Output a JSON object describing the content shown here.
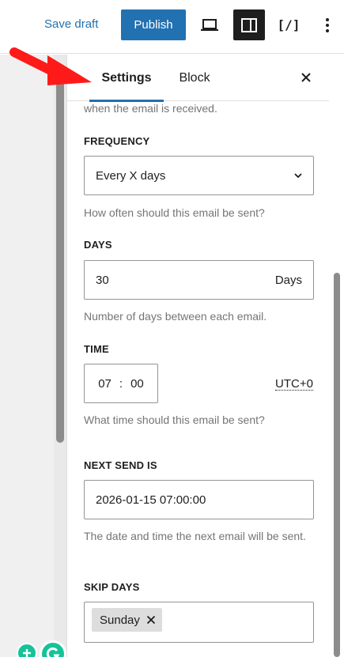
{
  "toolbar": {
    "save_draft_label": "Save draft",
    "publish_label": "Publish",
    "device_icon": "laptop-icon",
    "settings_icon": "sidebar-toggle-icon",
    "code_icon_label": "[/]",
    "more_icon": "more-vertical-icon"
  },
  "sidebar": {
    "tabs": [
      {
        "label": "Settings",
        "active": true
      },
      {
        "label": "Block",
        "active": false
      }
    ],
    "close_icon": "close-icon",
    "truncated_help": "when the email is received.",
    "frequency": {
      "label": "FREQUENCY",
      "value": "Every X days",
      "help": "How often should this email be sent?"
    },
    "days": {
      "label": "DAYS",
      "value": "30",
      "suffix": "Days",
      "help": "Number of days between each email."
    },
    "time": {
      "label": "TIME",
      "hours": "07",
      "separator": ":",
      "minutes": "00",
      "timezone": "UTC+0",
      "help": "What time should this email be sent?"
    },
    "next_send": {
      "label": "NEXT SEND IS",
      "value": "2026-01-15 07:00:00",
      "help": "The date and time the next email will be sent."
    },
    "skip_days": {
      "label": "SKIP DAYS",
      "tokens": [
        "Sunday"
      ]
    }
  },
  "colors": {
    "accent": "#2271b1",
    "arrow": "#ff1a1a",
    "grammarly": "#15c39a"
  }
}
